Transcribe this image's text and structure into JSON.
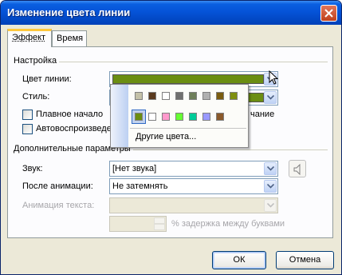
{
  "window": {
    "title": "Изменение цвета линии"
  },
  "tabs": [
    {
      "label": "Эффект"
    },
    {
      "label": "Время"
    }
  ],
  "settings": {
    "group_label": "Настройка",
    "line_color_label": "Цвет линии:",
    "line_color_value": "#6b8e12",
    "style_label": "Стиль:",
    "style_value_color": "#6b8e12",
    "smooth_start_label": "Плавное начало",
    "smooth_end_label_partial": "чание",
    "autoreverse_label": "Автовоспроизведе",
    "smooth_start_checked": false,
    "autoreverse_checked": false
  },
  "color_popup": {
    "top_row_colors": [
      "#c4c1a8",
      "#5a3a1e",
      "#ffffff",
      "#707070",
      "#6f7f5a",
      "#b0b0b0",
      "#7a5c10",
      "#7f8f10"
    ],
    "bottom_row_colors": [
      "#6b8e12",
      "#ffffff",
      "#ff99cc",
      "#66ff33",
      "#00cc99",
      "#9999ff",
      "#8b5a2b"
    ],
    "other_colors_label": "Другие цвета..."
  },
  "additional": {
    "group_label": "Дополнительные параметры",
    "sound_label": "Звук:",
    "sound_value": "[Нет звука]",
    "after_anim_label": "После анимации:",
    "after_anim_value": "Не затемнять",
    "text_anim_label": "Анимация текста:",
    "text_anim_value": "",
    "delay_label": "% задержка между буквами",
    "delay_value": ""
  },
  "buttons": {
    "ok": "ОК",
    "cancel": "Отмена"
  }
}
